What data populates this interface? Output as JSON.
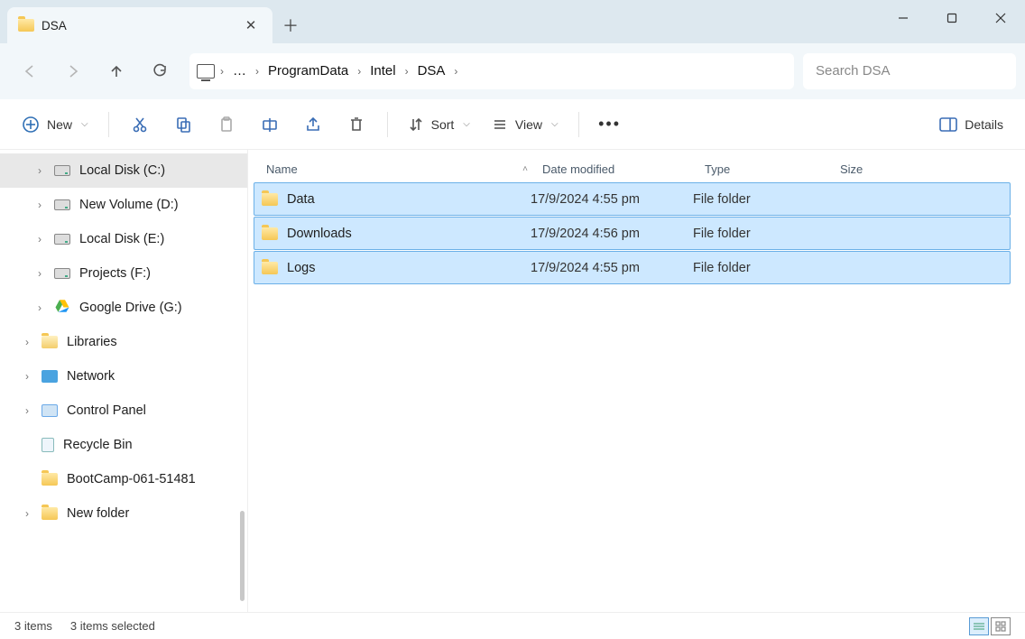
{
  "tab": {
    "title": "DSA"
  },
  "breadcrumbs": {
    "b0": "…",
    "b1": "ProgramData",
    "b2": "Intel",
    "b3": "DSA"
  },
  "search": {
    "placeholder": "Search DSA"
  },
  "toolbar": {
    "new": "New",
    "sort": "Sort",
    "view": "View",
    "details": "Details"
  },
  "columns": {
    "name": "Name",
    "date": "Date modified",
    "type": "Type",
    "size": "Size"
  },
  "rows": [
    {
      "name": "Data",
      "date": "17/9/2024 4:55 pm",
      "type": "File folder"
    },
    {
      "name": "Downloads",
      "date": "17/9/2024 4:56 pm",
      "type": "File folder"
    },
    {
      "name": "Logs",
      "date": "17/9/2024 4:55 pm",
      "type": "File folder"
    }
  ],
  "sidebar": {
    "i0": "Local Disk (C:)",
    "i1": "New Volume (D:)",
    "i2": "Local Disk (E:)",
    "i3": "Projects (F:)",
    "i4": "Google Drive (G:)",
    "i5": "Libraries",
    "i6": "Network",
    "i7": "Control Panel",
    "i8": "Recycle Bin",
    "i9": "BootCamp-061-51481",
    "i10": "New folder"
  },
  "status": {
    "count": "3 items",
    "selected": "3 items selected"
  }
}
